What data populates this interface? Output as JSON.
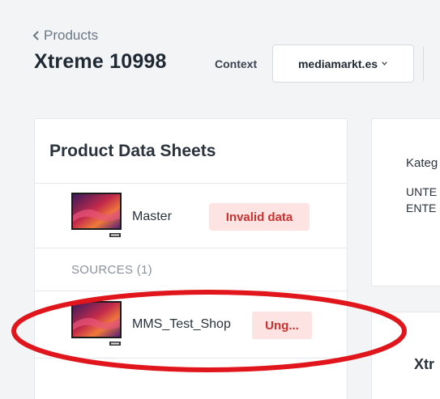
{
  "header": {
    "back_label": "Products",
    "title": "Xtreme 10998",
    "context_label": "Context",
    "context_value": "mediamarkt.es"
  },
  "left_card": {
    "title": "Product Data Sheets",
    "master": {
      "label": "Master",
      "badge": "Invalid data",
      "badge_color": "#c9322f"
    },
    "sources_label": "SOURCES (1)",
    "sources": [
      {
        "label": "MMS_Test_Shop",
        "badge": "Ung...",
        "badge_color": "#c9322f"
      }
    ]
  },
  "right_card": {
    "heading": "Kateg",
    "lines": [
      "UNTE",
      "ENTE"
    ]
  },
  "right_card_2": {
    "title": "Xtr"
  },
  "annotation": {
    "color": "#e0161c"
  },
  "icons": {
    "back": "chevron-left-icon",
    "dropdown": "chevron-down-icon",
    "thumbnail": "tv-thumbnail-icon"
  }
}
